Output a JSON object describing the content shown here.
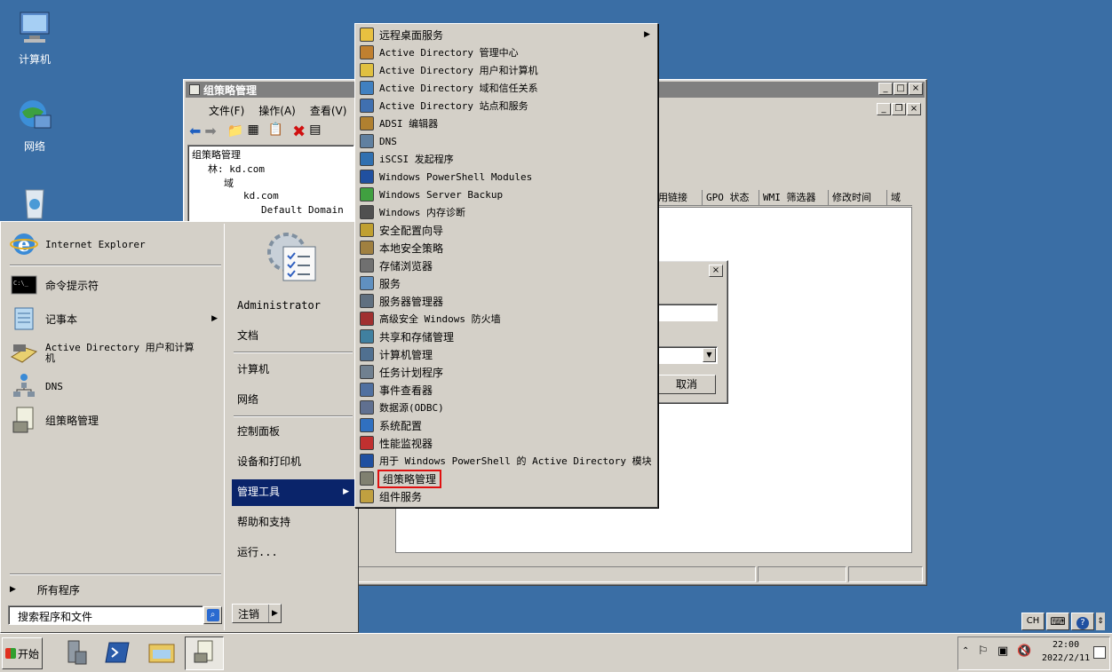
{
  "desktop": {
    "icons": [
      {
        "label": "计算机"
      },
      {
        "label": "网络"
      }
    ]
  },
  "gpm_window": {
    "title": "组策略管理",
    "menu": [
      "文件(F)",
      "操作(A)",
      "查看(V)"
    ],
    "tree": [
      "组策略管理",
      "林: kd.com",
      "域",
      "kd.com",
      "Default Domain"
    ],
    "columns": [
      "用链接",
      "GPO 状态",
      "WMI 筛选器",
      "修改时间",
      "域"
    ]
  },
  "dialog": {
    "cancel_label": "取消"
  },
  "start_menu": {
    "pinned": [
      {
        "label": "Internet Explorer",
        "icon": "ie-icon"
      },
      {
        "label": "命令提示符",
        "icon": "cmd-icon"
      },
      {
        "label": "记事本",
        "icon": "notepad-icon"
      },
      {
        "label": "Active Directory 用户和计算机",
        "icon": "ad-users-icon"
      },
      {
        "label": "DNS",
        "icon": "dns-icon"
      },
      {
        "label": "组策略管理",
        "icon": "gpm-icon"
      }
    ],
    "all_programs": "所有程序",
    "search_placeholder": "搜索程序和文件",
    "right": {
      "user": "Administrator",
      "documents": "文档",
      "computer": "计算机",
      "network": "网络",
      "control_panel": "控制面板",
      "devices": "设备和打印机",
      "admin_tools": "管理工具",
      "help": "帮助和支持",
      "run": "运行..."
    },
    "logoff": "注销"
  },
  "submenu": {
    "items": [
      {
        "label": "远程桌面服务",
        "color": "#e8c040"
      },
      {
        "label": "Active Directory 管理中心",
        "color": "#c08030"
      },
      {
        "label": "Active Directory 用户和计算机",
        "color": "#e0c040"
      },
      {
        "label": "Active Directory 域和信任关系",
        "color": "#4080c0"
      },
      {
        "label": "Active Directory 站点和服务",
        "color": "#4070b0"
      },
      {
        "label": "ADSI 编辑器",
        "color": "#b08030"
      },
      {
        "label": "DNS",
        "color": "#6080a0"
      },
      {
        "label": "iSCSI 发起程序",
        "color": "#3070b0"
      },
      {
        "label": "Windows PowerShell Modules",
        "color": "#2050a0"
      },
      {
        "label": "Windows Server Backup",
        "color": "#40a040"
      },
      {
        "label": "Windows 内存诊断",
        "color": "#505050"
      },
      {
        "label": "安全配置向导",
        "color": "#c0a030"
      },
      {
        "label": "本地安全策略",
        "color": "#a08040"
      },
      {
        "label": "存储浏览器",
        "color": "#707070"
      },
      {
        "label": "服务",
        "color": "#6090c0"
      },
      {
        "label": "服务器管理器",
        "color": "#607080"
      },
      {
        "label": "高级安全 Windows 防火墙",
        "color": "#a03030"
      },
      {
        "label": "共享和存储管理",
        "color": "#4080a0"
      },
      {
        "label": "计算机管理",
        "color": "#507090"
      },
      {
        "label": "任务计划程序",
        "color": "#708090"
      },
      {
        "label": "事件查看器",
        "color": "#5070a0"
      },
      {
        "label": "数据源(ODBC)",
        "color": "#607090"
      },
      {
        "label": "系统配置",
        "color": "#3070c0"
      },
      {
        "label": "性能监视器",
        "color": "#c03030"
      },
      {
        "label": "用于 Windows PowerShell 的 Active Directory 模块",
        "color": "#2050a0"
      },
      {
        "label": "组策略管理",
        "color": "#808070"
      },
      {
        "label": "组件服务",
        "color": "#c0a040"
      }
    ]
  },
  "taskbar": {
    "start_label": "开始",
    "lang": "CH",
    "time": "22:00",
    "date": "2022/2/11"
  }
}
